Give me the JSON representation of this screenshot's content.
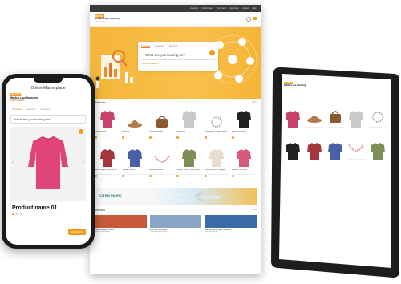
{
  "desktop": {
    "topbar_links": [
      "About Us",
      "Our Company",
      "Our Brands",
      "Newsroom",
      "Contact",
      "Login"
    ],
    "brand": {
      "tag": "HKTDC",
      "line1": "Hidden Lace Sourcing",
      "line2": "Marketplace"
    },
    "search": {
      "tabs": [
        "Products",
        "Suppliers",
        "Services"
      ],
      "placeholder": "What are you looking for?",
      "advanced": "Advanced Search"
    },
    "products_title": "Products",
    "more_label": "More",
    "products": [
      {
        "caption": "Knitted top 2019",
        "color": "#c8426b",
        "kind": "top"
      },
      {
        "caption": "Wool Hat",
        "color": "#b07a4a",
        "kind": "hat"
      },
      {
        "caption": "Leather Handbag",
        "color": "#8a5a2e",
        "kind": "bag"
      },
      {
        "caption": "Knitted top",
        "color": "#c9c9c9",
        "kind": "top"
      },
      {
        "caption": "Silver Brooch - Hand Crafted",
        "color": "#9b9b9b",
        "kind": "brooch"
      },
      {
        "caption": "Black Knit Sweater",
        "color": "#222222",
        "kind": "top"
      },
      {
        "caption": "Shell Cardigan Cotton & Silk",
        "color": "#a5363d",
        "kind": "top"
      },
      {
        "caption": "Striped Pullover",
        "color": "#4b5fa8",
        "kind": "top"
      },
      {
        "caption": "Beaded Necklace",
        "color": "#e88d8d",
        "kind": "neck"
      },
      {
        "caption": "Woolen Jacket - Sage Green",
        "color": "#7e8f55",
        "kind": "top"
      },
      {
        "caption": "Cashmere Scarf / Cardigan Beige",
        "color": "#e9ddd0",
        "kind": "top"
      },
      {
        "caption": "Knitwear Collection",
        "color": "#d65a7a",
        "kind": "top"
      }
    ],
    "banner_logo": "CATHAY PACIFIC",
    "services_title": "Services",
    "services": [
      {
        "title": "Fast Worldwide Courier",
        "desc": "Logistics and delivery",
        "color": "#c85a3a"
      },
      {
        "title": "Sourcing Consultant",
        "desc": "Product sourcing advice",
        "color": "#8aa4c8"
      },
      {
        "title": "International Freight Forwarder",
        "desc": "Sea and air cargo",
        "color": "#3a6aa8"
      }
    ]
  },
  "phone": {
    "title": "Online Marketplace",
    "brand": {
      "tag": "HKTDC",
      "line1": "Hidden Lace Sourcing",
      "line2": "Marketplace"
    },
    "tabs": [
      "Products",
      "Services",
      "Suppliers"
    ],
    "search_placeholder": "What are you looking for?",
    "product_name": "Product name 01",
    "enquire": "ENQUIRE"
  },
  "tablet": {
    "brand": {
      "tag": "HKTDC",
      "line1": "Hidden Lace Sourcing",
      "line2": "Marketplace"
    }
  },
  "colors": {
    "accent": "#f39a1e",
    "hero": "#f6b63f",
    "brand_orange": "#e4752a"
  }
}
